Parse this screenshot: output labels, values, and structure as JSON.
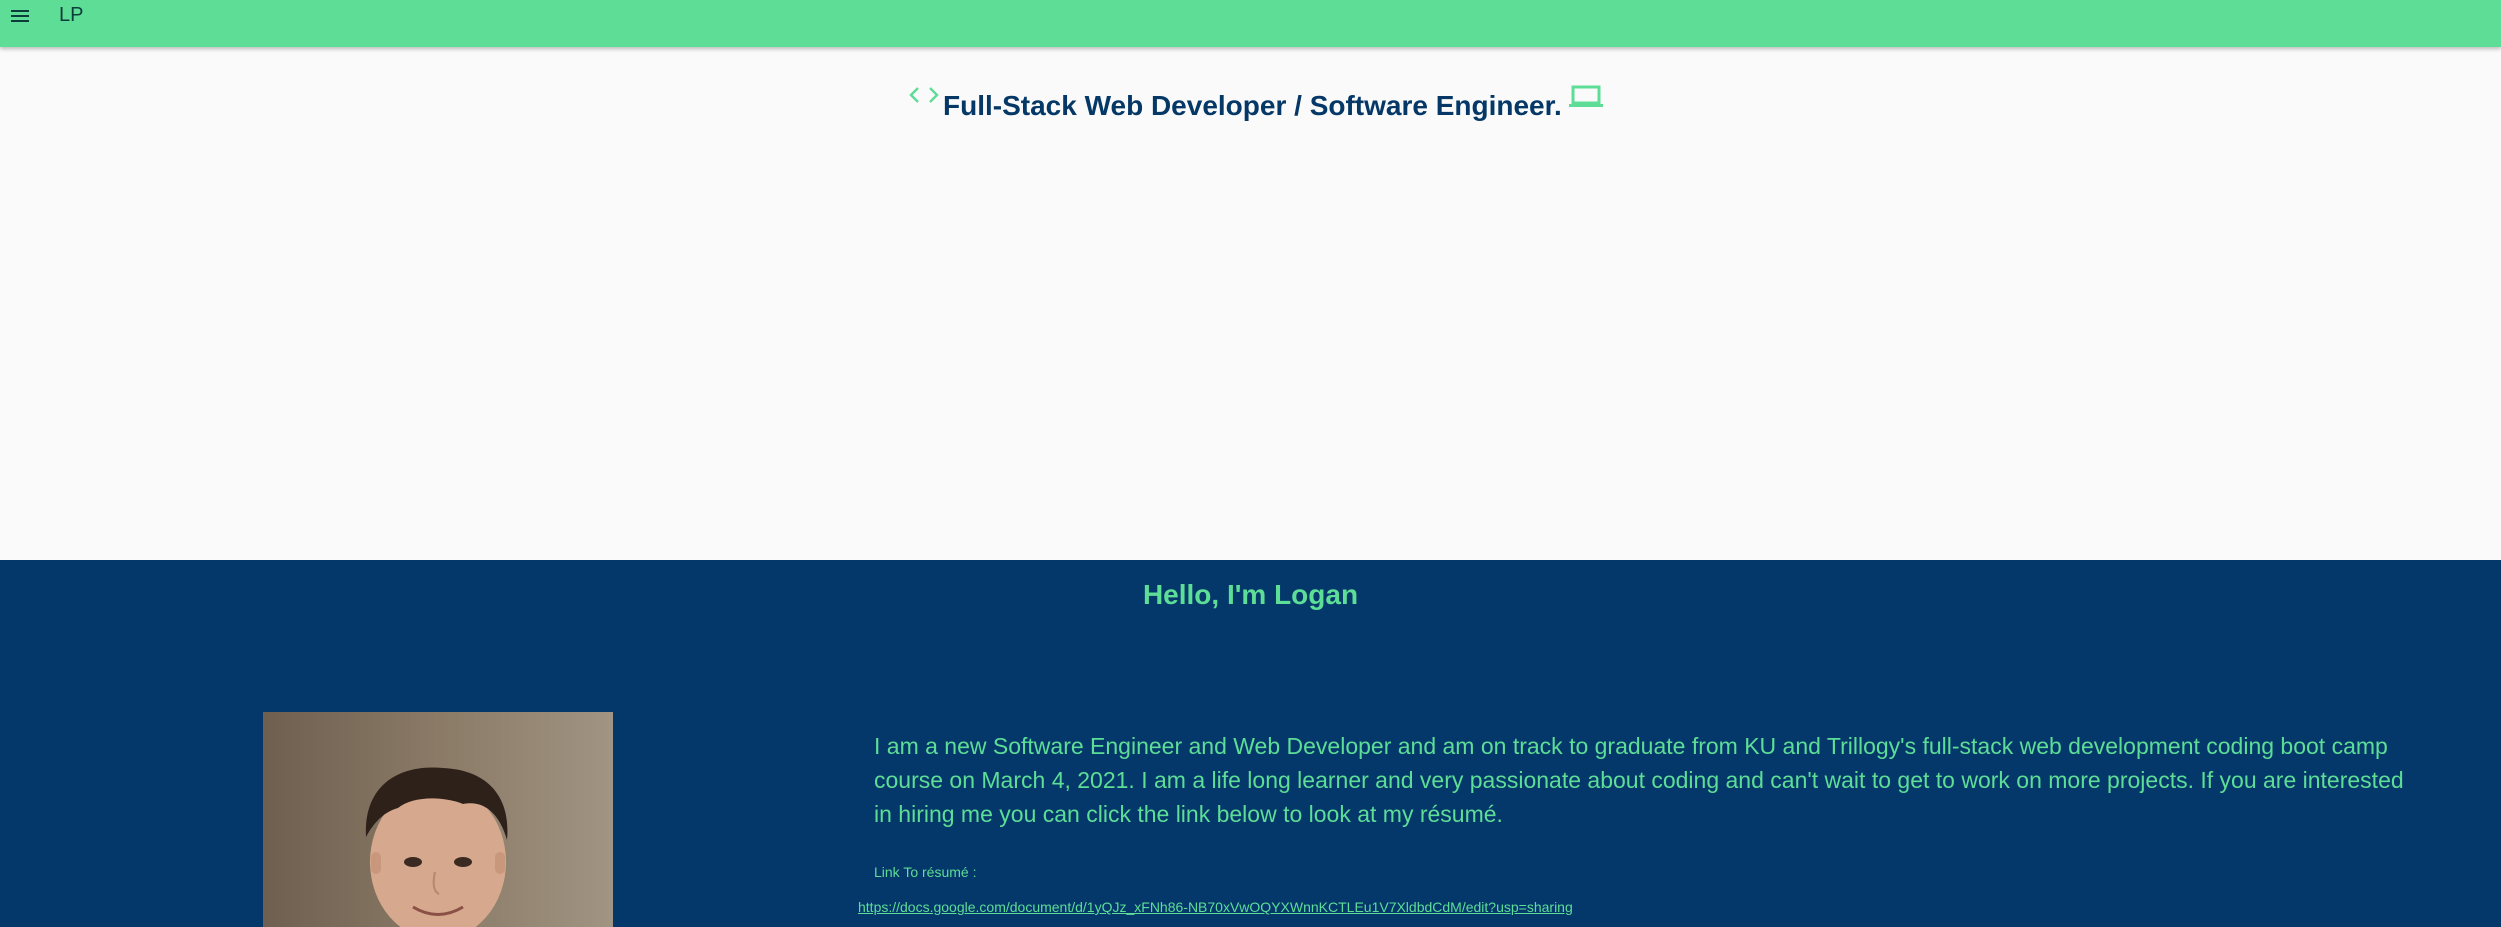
{
  "appbar": {
    "menu_icon": "menu-icon",
    "brand": "LP",
    "background": "#5ddd96"
  },
  "hero": {
    "left_icon": "code-icon",
    "title": "Full-Stack Web Developer / Software Engineer.",
    "right_icon": "laptop-icon",
    "title_color": "#053866",
    "icon_color": "#5ddd96"
  },
  "about": {
    "heading": "Hello, I'm Logan",
    "photo": "profile-photo",
    "bio": "I am a new Software Engineer and Web Developer and am on track to graduate from KU and Trillogy's full-stack web development coding boot camp course on March 4, 2021. I am a life long learner and very passionate about coding and can't wait to get to work on more projects. If you are interested in hiring me you can click the link below to look at my résumé.",
    "resume_label": "Link To résumé :",
    "resume_url": "https://docs.google.com/document/d/1yQJz_xFNh86-NB70xVwOQYXWnnKCTLEu1V7XldbdCdM/edit?usp=sharing",
    "background": "#04386b",
    "text_color": "#5ddd96"
  }
}
